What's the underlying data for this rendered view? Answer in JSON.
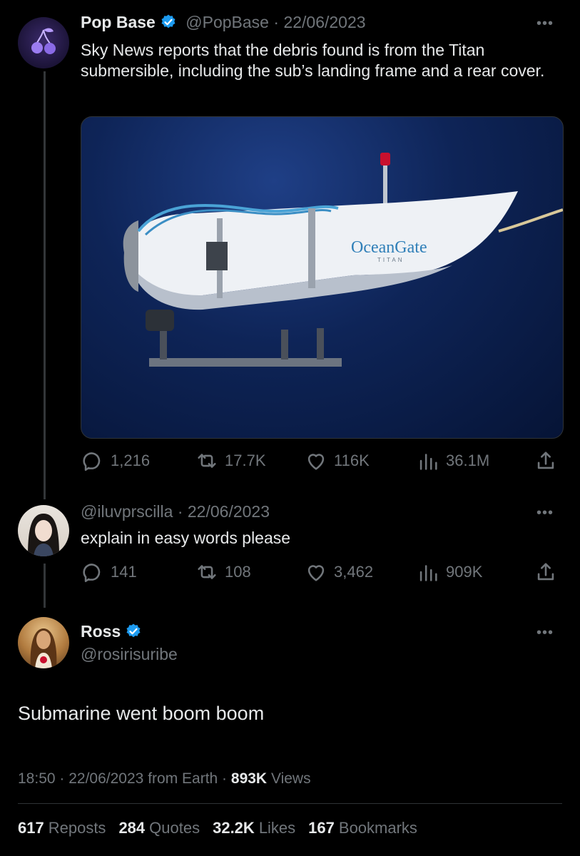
{
  "tweet1": {
    "name": "Pop Base",
    "handle": "@PopBase",
    "date": "22/06/2023",
    "text": "Sky News reports that the debris found is from the Titan submersible, including the sub’s landing frame and a rear cover.",
    "image_logo": "OceanGate",
    "image_logo_sub": "TITAN",
    "replies": "1,216",
    "reposts": "17.7K",
    "likes": "116K",
    "views": "36.1M"
  },
  "tweet2": {
    "handle": "@iluvprscilla",
    "date": "22/06/2023",
    "text": "explain in easy words please",
    "replies": "141",
    "reposts": "108",
    "likes": "3,462",
    "views": "909K"
  },
  "main": {
    "name": "Ross",
    "handle": "@rosirisuribe",
    "text": "Submarine went boom boom",
    "time": "18:50",
    "date": "22/06/2023",
    "source": "from Earth",
    "views_count": "893K",
    "views_label": "Views",
    "reposts_count": "617",
    "reposts_label": "Reposts",
    "quotes_count": "284",
    "quotes_label": "Quotes",
    "likes_count": "32.2K",
    "likes_label": "Likes",
    "bookmarks_count": "167",
    "bookmarks_label": "Bookmarks"
  },
  "colors": {
    "background": "#000000",
    "verified": "#1d9bf0",
    "muted": "#71767b",
    "text": "#e7e9ea"
  },
  "icons": [
    "reply-icon",
    "repost-icon",
    "like-icon",
    "views-icon",
    "share-icon",
    "verified-icon",
    "more-icon"
  ]
}
